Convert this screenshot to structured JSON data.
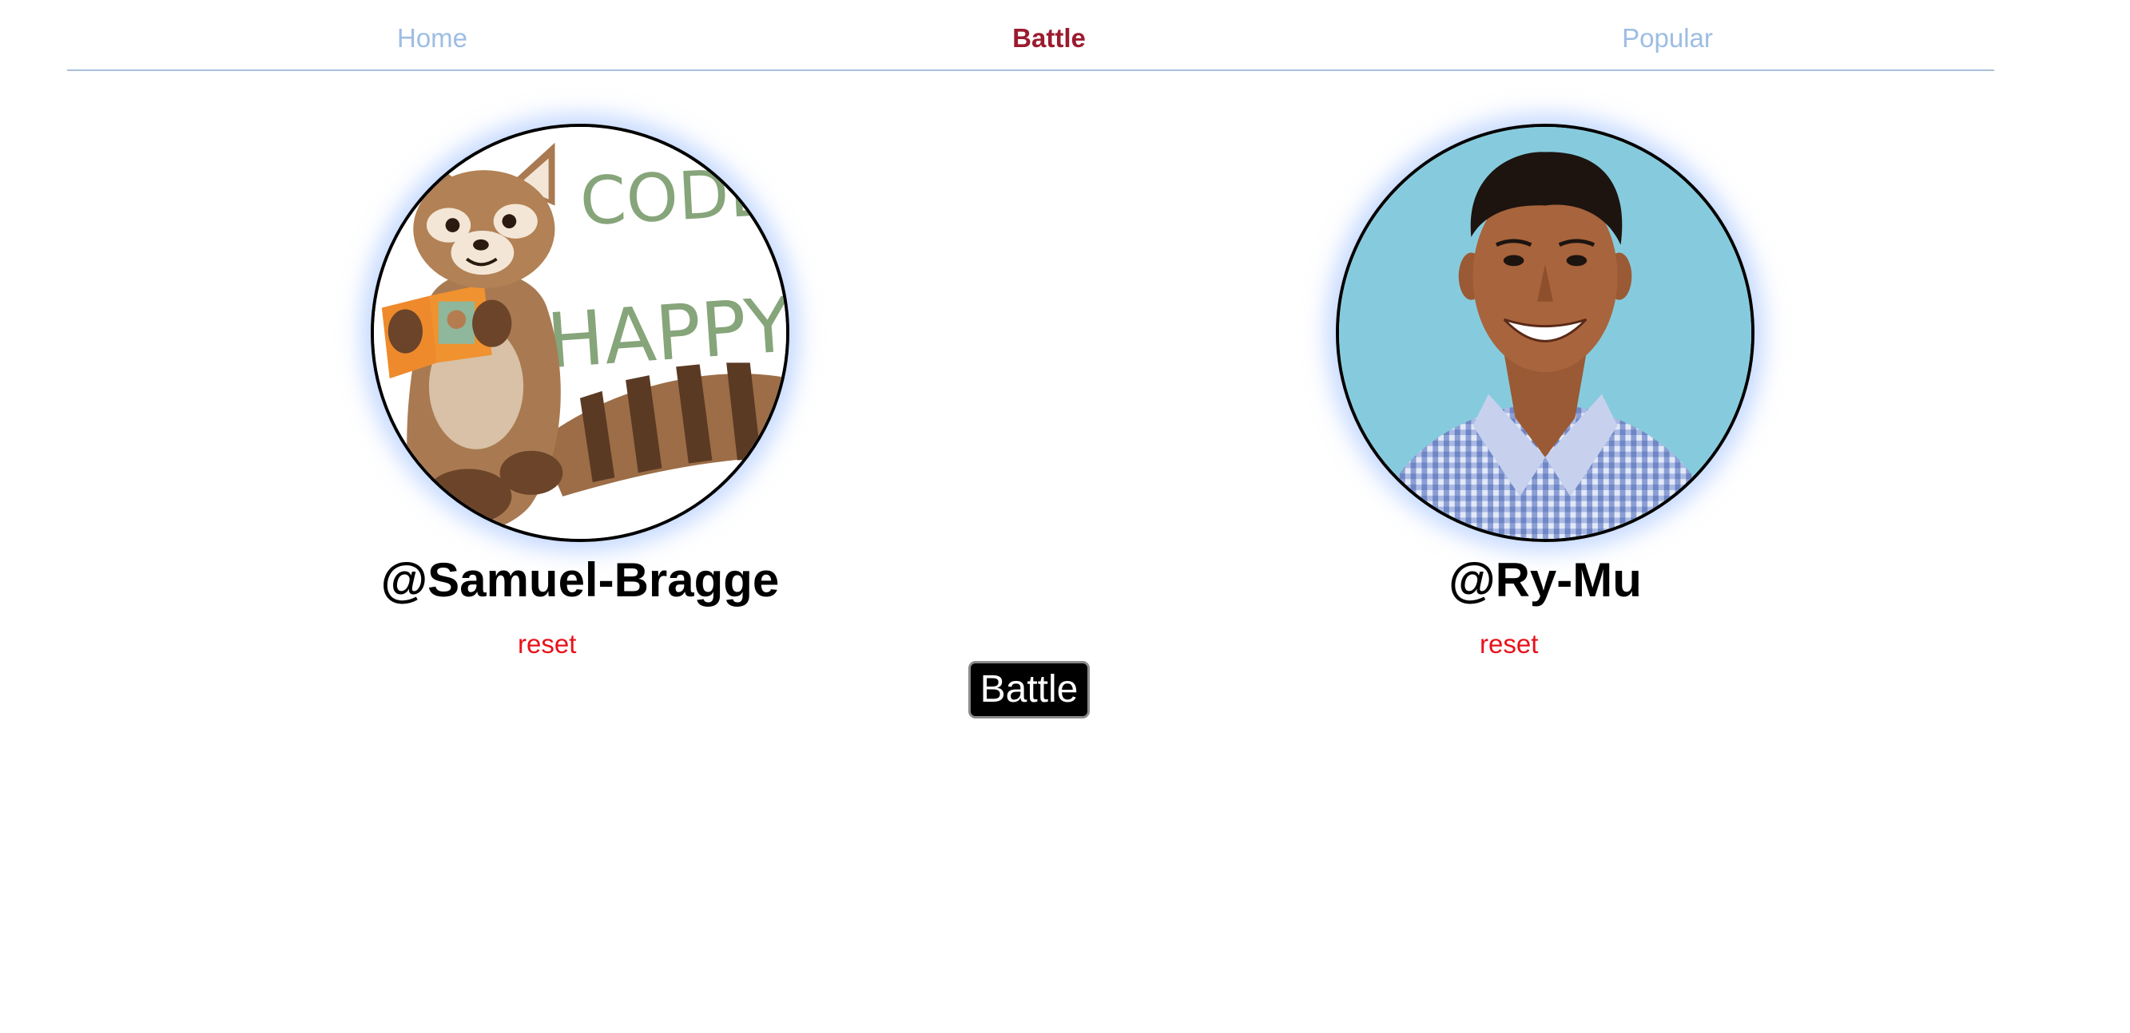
{
  "nav": {
    "items": [
      {
        "label": "Home",
        "active": false
      },
      {
        "label": "Battle",
        "active": true
      },
      {
        "label": "Popular",
        "active": false
      }
    ]
  },
  "players": [
    {
      "username": "@Samuel-Bragge",
      "reset_label": "reset",
      "avatar": {
        "description_icon": "red-panda-avatar",
        "text_lines": [
          "CODE",
          "HAPPY"
        ]
      }
    },
    {
      "username": "@Ry-Mu",
      "reset_label": "reset",
      "avatar": {
        "description_icon": "person-photo-avatar"
      }
    }
  ],
  "battle_button": {
    "label": "Battle"
  },
  "colors": {
    "nav_inactive": "#9ebde4",
    "nav_active": "#9b1b2e",
    "reset": "#e8121b",
    "avatar_glow": "#96b9ff",
    "button_bg": "#000000"
  }
}
